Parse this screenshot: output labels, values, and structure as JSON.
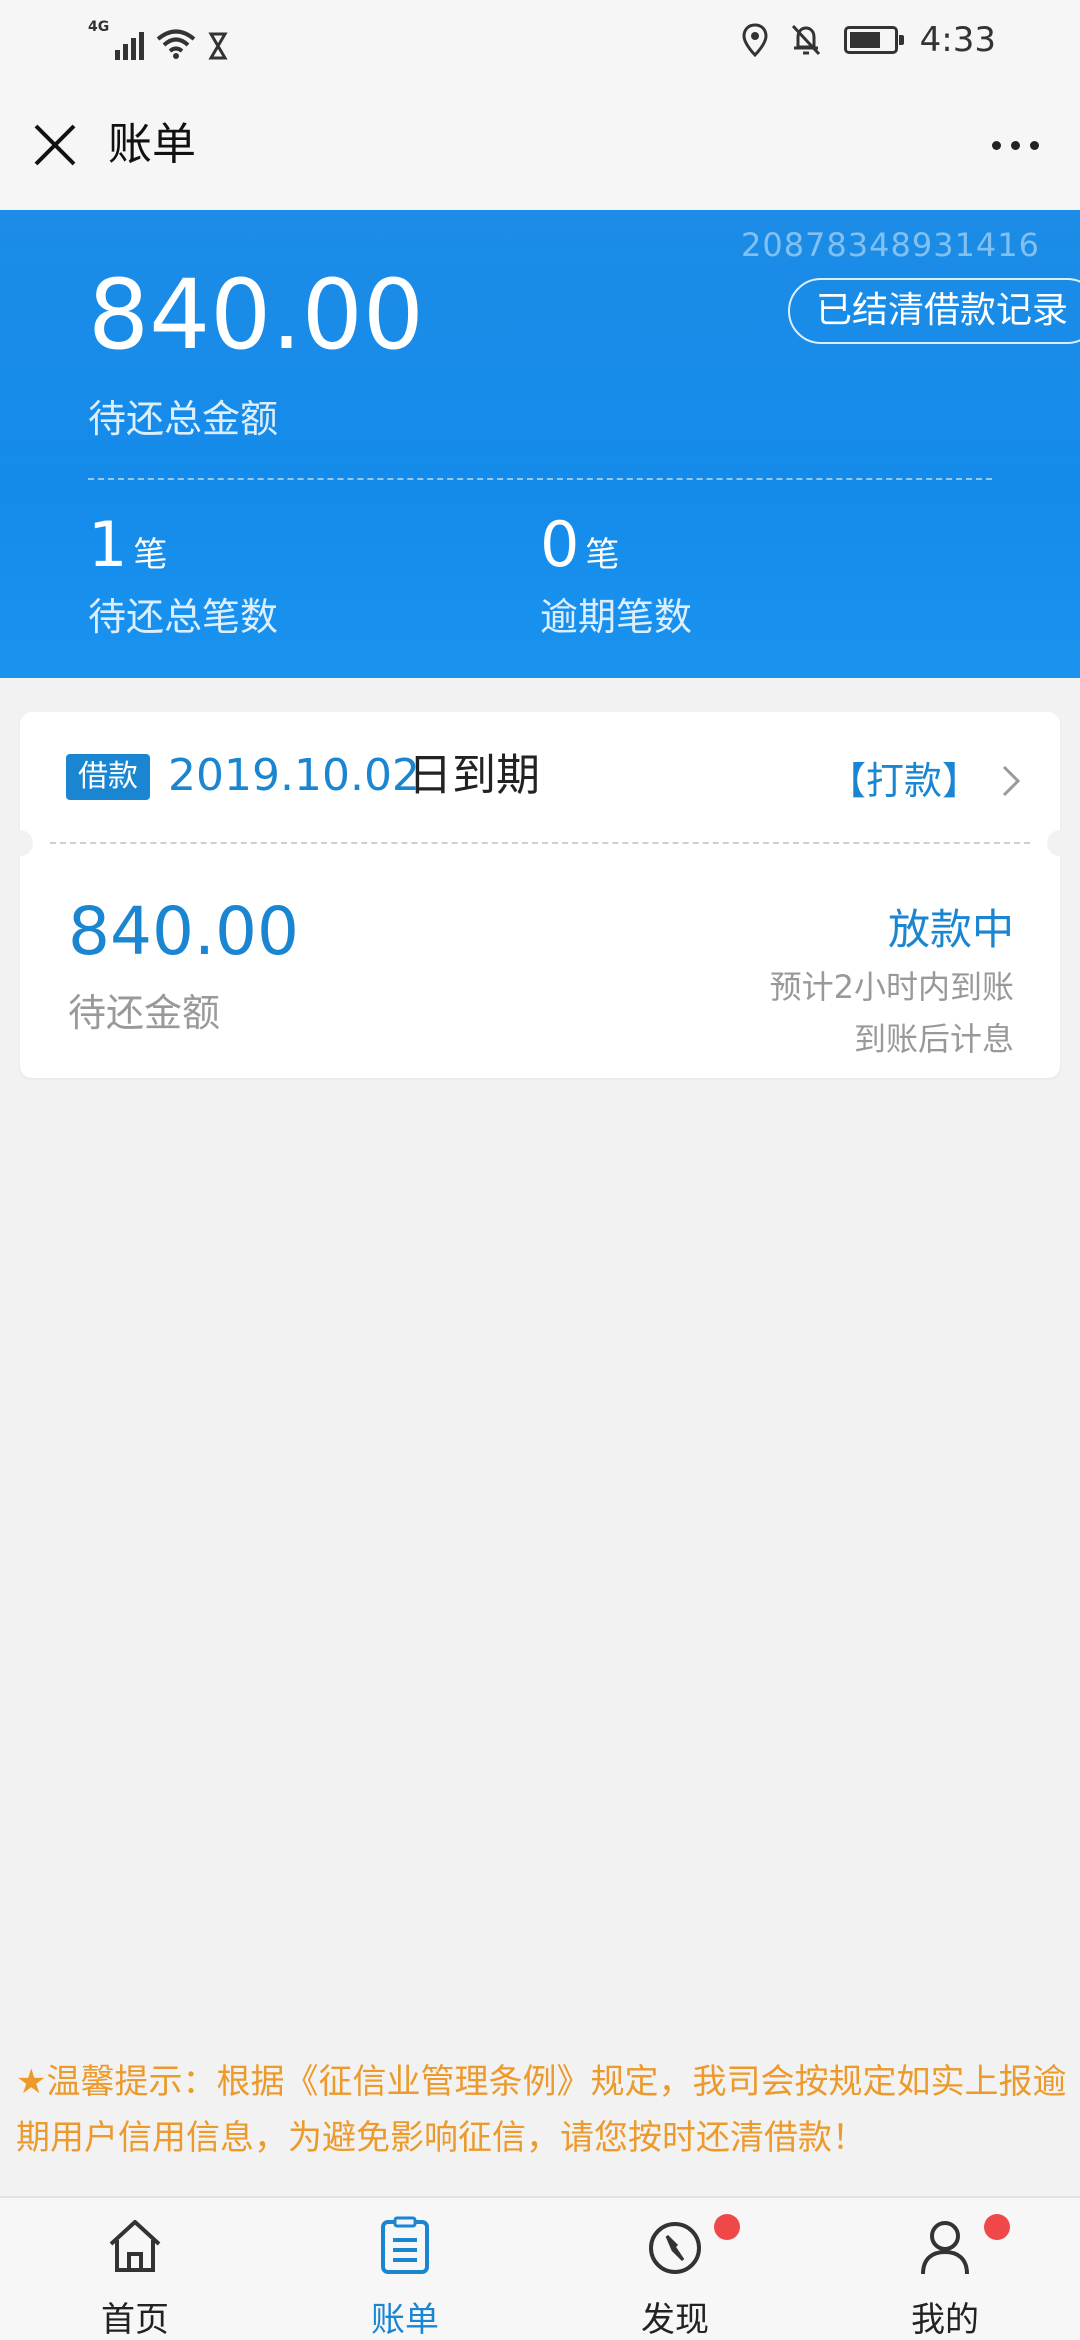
{
  "status_bar": {
    "network": "4G",
    "time": "4:33",
    "icons": [
      "signal-icon",
      "wifi-icon",
      "hourglass-icon",
      "location-icon",
      "bell-off-icon",
      "battery-icon"
    ]
  },
  "nav": {
    "title": "账单",
    "icons": [
      "close-icon",
      "more-icon"
    ]
  },
  "summary": {
    "order_no": "20878348931416",
    "total_amount": "840.00",
    "total_label": "待还总金额",
    "history_button": "已结清借款记录",
    "pending_count": "1",
    "pending_unit": "笔",
    "pending_label": "待还总笔数",
    "overdue_count": "0",
    "overdue_unit": "笔",
    "overdue_label": "逾期笔数"
  },
  "bill": {
    "tag": "借款",
    "due_date": "2019.10.02",
    "due_suffix": "日到期",
    "pay_link": "【打款】",
    "amount": "840.00",
    "amount_label": "待还金额",
    "status": "放款中",
    "note1": "预计2小时内到账",
    "note2": "到账后计息"
  },
  "notice": "★温馨提示：根据《征信业管理条例》规定，我司会按规定如实上报逾期用户信用信息，为避免影响征信，请您按时还清借款！",
  "tabs": [
    {
      "label": "首页",
      "icon": "home-icon",
      "active": false,
      "badge": false
    },
    {
      "label": "账单",
      "icon": "bill-icon",
      "active": true,
      "badge": false
    },
    {
      "label": "发现",
      "icon": "compass-icon",
      "active": false,
      "badge": true
    },
    {
      "label": "我的",
      "icon": "user-icon",
      "active": false,
      "badge": true
    }
  ],
  "colors": {
    "accent": "#1a86d2",
    "header_blue": "#148bea",
    "notice_orange": "#ec9a2c",
    "badge_red": "#f04848"
  }
}
